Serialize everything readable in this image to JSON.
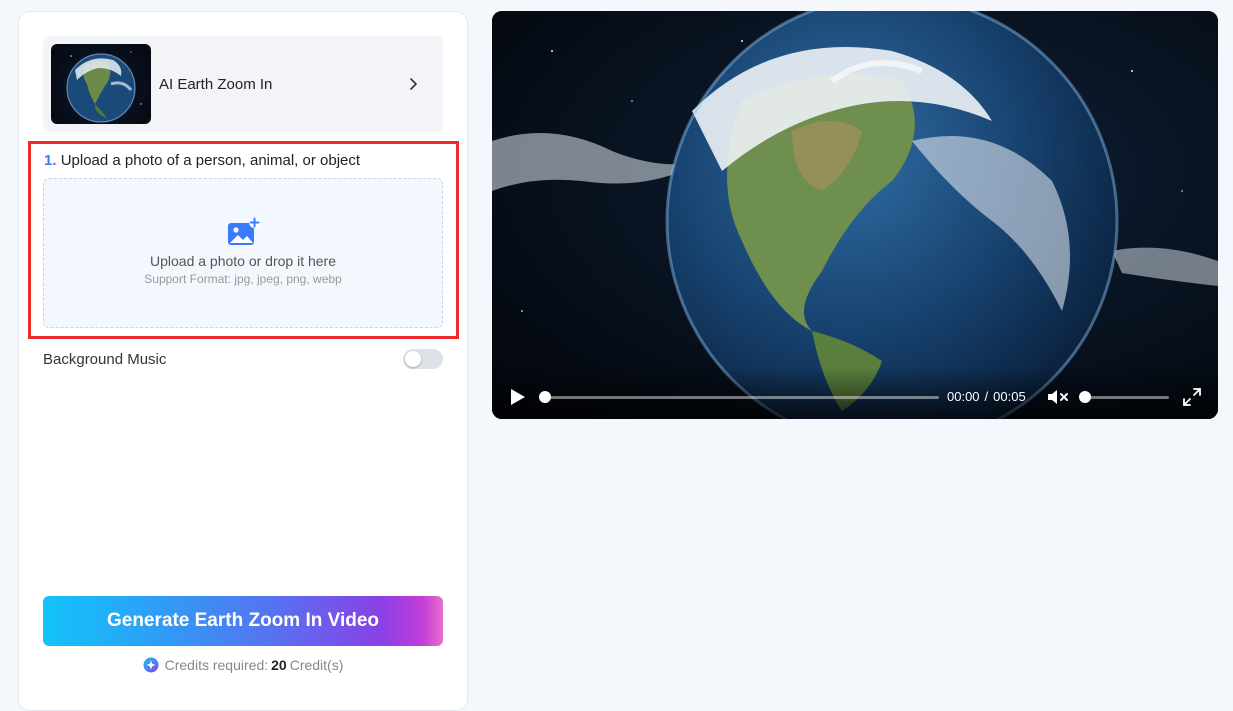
{
  "template": {
    "title": "AI Earth Zoom In"
  },
  "upload": {
    "step_number": "1.",
    "step_label": "Upload a photo of a person, animal, or object",
    "drop_text": "Upload a photo or drop it here",
    "format_text": "Support Format: jpg, jpeg, png, webp"
  },
  "music": {
    "label": "Background Music",
    "enabled": false
  },
  "generate": {
    "label": "Generate Earth Zoom In Video"
  },
  "credits": {
    "prefix": "Credits required:",
    "amount": "20",
    "suffix": "Credit(s)"
  },
  "video": {
    "current_time": "00:00",
    "separator": "/",
    "duration": "00:05",
    "progress": 0,
    "volume": 0,
    "muted": true
  },
  "colors": {
    "accent": "#3a7afe",
    "highlight_border": "#ee2b2b",
    "button_gradient_start": "#12c4fb",
    "button_gradient_end": "#e86fcc"
  },
  "icons": {
    "chevron": "chevron-right-icon",
    "upload": "image-upload-icon",
    "credit": "credit-icon",
    "play": "play-icon",
    "mute": "volume-mute-icon",
    "fullscreen": "fullscreen-icon"
  }
}
